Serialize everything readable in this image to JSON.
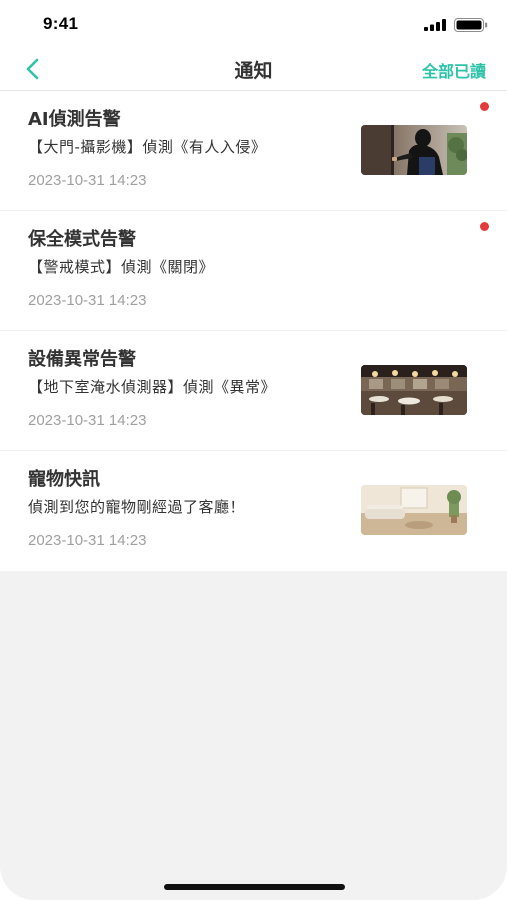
{
  "status_bar": {
    "time": "9:41",
    "icons": [
      "signal-icon",
      "battery-icon"
    ]
  },
  "nav": {
    "back_icon": "chevron-left-icon",
    "title": "通知",
    "mark_all_read_label": "全部已讀",
    "accent_color": "#2cc3a8"
  },
  "notifications": [
    {
      "title": "AI偵測告警",
      "description": "【大門-攝影機】偵測《有人入侵》",
      "timestamp": "2023-10-31 14:23",
      "unread": true,
      "thumbnail": "intruder-at-door-image"
    },
    {
      "title": "保全模式告警",
      "description": "【警戒模式】偵測《關閉》",
      "timestamp": "2023-10-31 14:23",
      "unread": true,
      "thumbnail": null
    },
    {
      "title": "設備異常告警",
      "description": "【地下室淹水偵測器】偵測《異常》",
      "timestamp": "2023-10-31 14:23",
      "unread": false,
      "thumbnail": "restaurant-interior-image"
    },
    {
      "title": "寵物快訊",
      "description": "偵測到您的寵物剛經過了客廳！",
      "timestamp": "2023-10-31 14:23",
      "unread": false,
      "thumbnail": "living-room-image"
    }
  ],
  "colors": {
    "unread_dot": "#e53a3a",
    "timestamp": "#a0a0a0",
    "background": "#f2f2f2"
  }
}
